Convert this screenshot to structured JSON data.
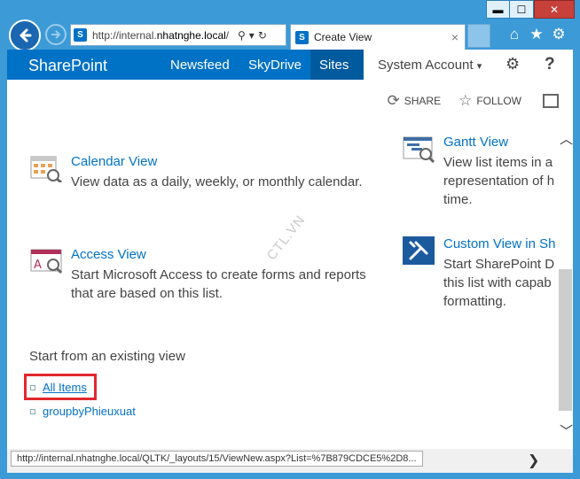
{
  "browser": {
    "url_prefix": "http://internal.",
    "url_host": "nhatnghe.local",
    "url_suffix": "/",
    "tab_title": "Create View",
    "tab_close": "×",
    "min_label": "▬",
    "max_label": "☐",
    "close_label": "✕"
  },
  "suitebar": {
    "brand": "SharePoint",
    "links": [
      "Newsfeed",
      "SkyDrive",
      "Sites"
    ],
    "account": "System Account",
    "help": "?"
  },
  "actions": {
    "share": "SHARE",
    "follow": "FOLLOW"
  },
  "views": {
    "calendar": {
      "title": "Calendar View",
      "desc": "View data as a daily, weekly, or monthly calendar."
    },
    "access": {
      "title": "Access View",
      "desc_line1": "Start Microsoft Access to create forms and reports",
      "desc_line2": "that are based on this list."
    },
    "gantt": {
      "title": "Gantt View",
      "desc_line1": "View list items in a",
      "desc_line2": "representation of h",
      "desc_line3": "time."
    },
    "custom": {
      "title": "Custom View in Sh",
      "desc_line1": "Start SharePoint D",
      "desc_line2": "this list with capab",
      "desc_line3": "formatting."
    }
  },
  "existing": {
    "label": "Start from an existing view",
    "items": [
      "All Items",
      "groupbyPhieuxuat"
    ]
  },
  "watermark": "CTL.VN",
  "status": {
    "url": "http://internal.nhatnghe.local/QLTK/_layouts/15/ViewNew.aspx?List=%7B879CDCE5%2D8..."
  },
  "colors": {
    "accent": "#0072c6",
    "chrome": "#3c9bd6",
    "highlight": "#e0282e"
  }
}
